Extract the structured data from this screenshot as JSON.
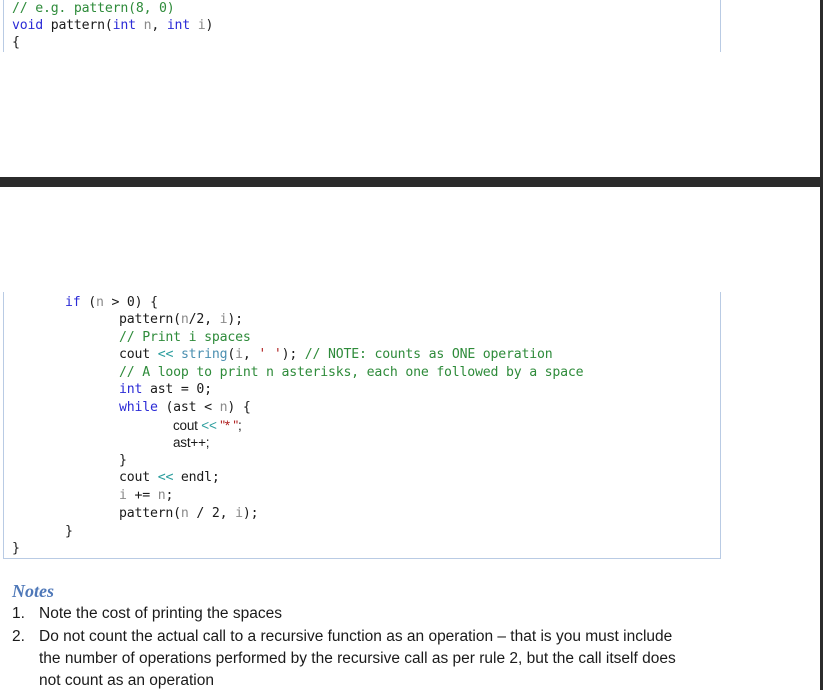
{
  "top_code": {
    "line1": "// e.g. pattern(8, 0)",
    "line2_kw1": "void",
    "line2_fn": " pattern(",
    "line2_kw2": "int",
    "line2_p1": " n",
    "line2_sep": ", ",
    "line2_kw3": "int",
    "line2_p2": " i",
    "line2_end": ")",
    "line3": "{"
  },
  "mid_code": {
    "if_kw": "if",
    "if_open": " (",
    "if_n": "n",
    "if_rest": " > 0) {",
    "call1_a": "pattern(",
    "call1_n": "n",
    "call1_b": "/2, ",
    "call1_i": "i",
    "call1_c": ");",
    "comment1": "// Print i spaces",
    "cout1_a": "cout ",
    "cout1_op": "<<",
    "cout1_sp": " ",
    "cout1_ty": "string",
    "cout1_b": "(",
    "cout1_i": "i",
    "cout1_c": ", ",
    "cout1_str": "' '",
    "cout1_d": "); ",
    "cout1_cm": "// NOTE: counts as ONE operation",
    "comment2": "// A loop to print n asterisks, each one followed by a space",
    "int_kw": "int",
    "int_rest": " ast = 0;",
    "while_kw": "while",
    "while_a": " (ast < ",
    "while_n": "n",
    "while_b": ") {",
    "inner_cout_a": "cout ",
    "inner_cout_op": "<<",
    "inner_cout_str": " \"* \"",
    "inner_cout_end": ";",
    "inner_inc": "ast++;",
    "close_while": "}",
    "endl_a": "cout ",
    "endl_op": "<<",
    "endl_b": " endl;",
    "incr_i": "i",
    "incr_mid": " += ",
    "incr_n": "n",
    "incr_end": ";",
    "call2_a": "pattern(",
    "call2_n": "n",
    "call2_b": " / 2, ",
    "call2_i": "i",
    "call2_c": ");",
    "close_if": "}",
    "close_fn": "}"
  },
  "notes": {
    "title": "Notes",
    "items": [
      {
        "num": "1.",
        "lines": [
          "Note the cost of printing the spaces"
        ]
      },
      {
        "num": "2.",
        "lines": [
          "Do not count the actual call to a recursive function as an operation – that is you must include",
          "the number of operations performed by the recursive call as per rule 2, but the call itself does",
          "not count as an operation"
        ]
      }
    ]
  }
}
